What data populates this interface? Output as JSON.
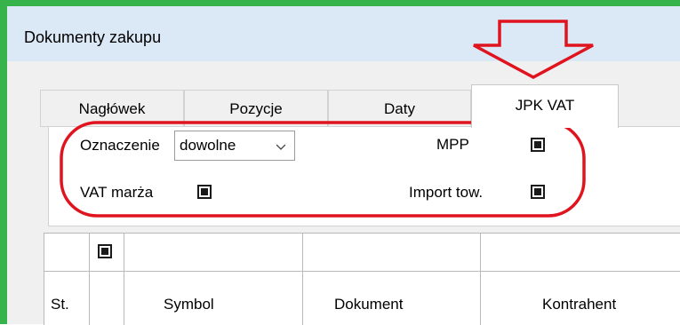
{
  "window": {
    "title": "Dokumenty zakupu"
  },
  "tabs": [
    {
      "label": "Nagłówek"
    },
    {
      "label": "Pozycje"
    },
    {
      "label": "Daty"
    },
    {
      "label": "JPK VAT"
    }
  ],
  "active_tab": "JPK VAT",
  "jpk": {
    "oznaczenie_label": "Oznaczenie",
    "oznaczenie_value": "dowolne",
    "vat_marza_label": "VAT marża",
    "vat_marza_state": "indeterminate",
    "mpp_label": "MPP",
    "mpp_state": "indeterminate",
    "import_label": "Import tow.",
    "import_state": "indeterminate"
  },
  "table": {
    "filter_checkbox_state": "indeterminate",
    "columns": [
      "St.",
      "Symbol",
      "Dokument",
      "Kontrahent"
    ]
  },
  "annotations": {
    "arrow_color": "#e0141e",
    "ellipse_color": "#e0141e",
    "frame_color": "#36b34a"
  }
}
